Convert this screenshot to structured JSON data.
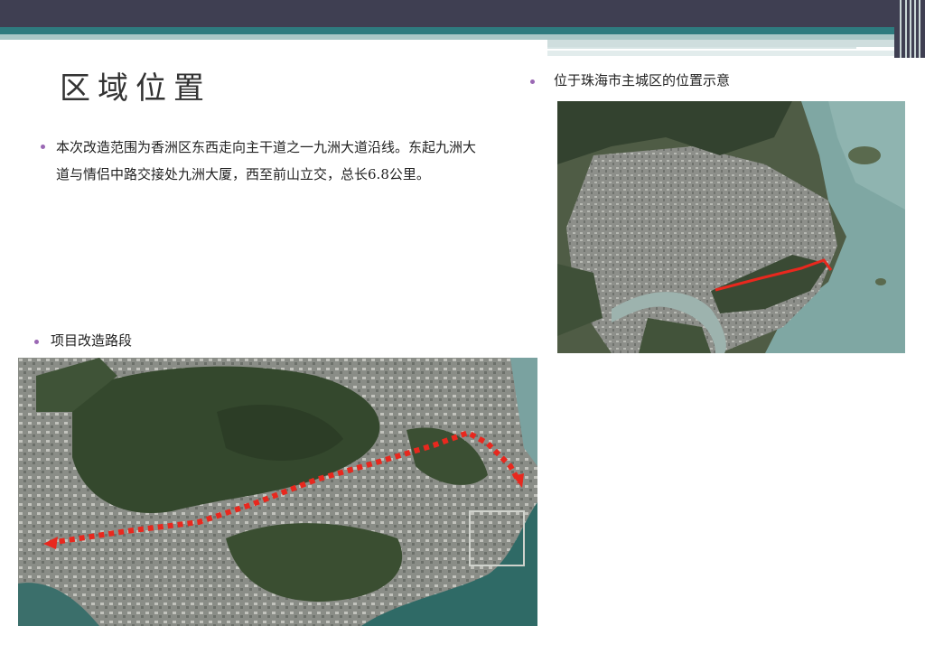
{
  "slide": {
    "title": "区域位置",
    "description": "本次改造范围为香洲区东西走向主干道之一九洲大道沿线。东起九洲大道与情侣中路交接处九洲大厦，西至前山立交，总长6.8公里。",
    "section_route_label": "项目改造路段",
    "section_location_label": "位于珠海市主城区的位置示意"
  },
  "colors": {
    "header_dark": "#3f3f52",
    "header_teal": "#2e7b7f",
    "bullet": "#9a68b4",
    "route_red": "#e8281e"
  }
}
